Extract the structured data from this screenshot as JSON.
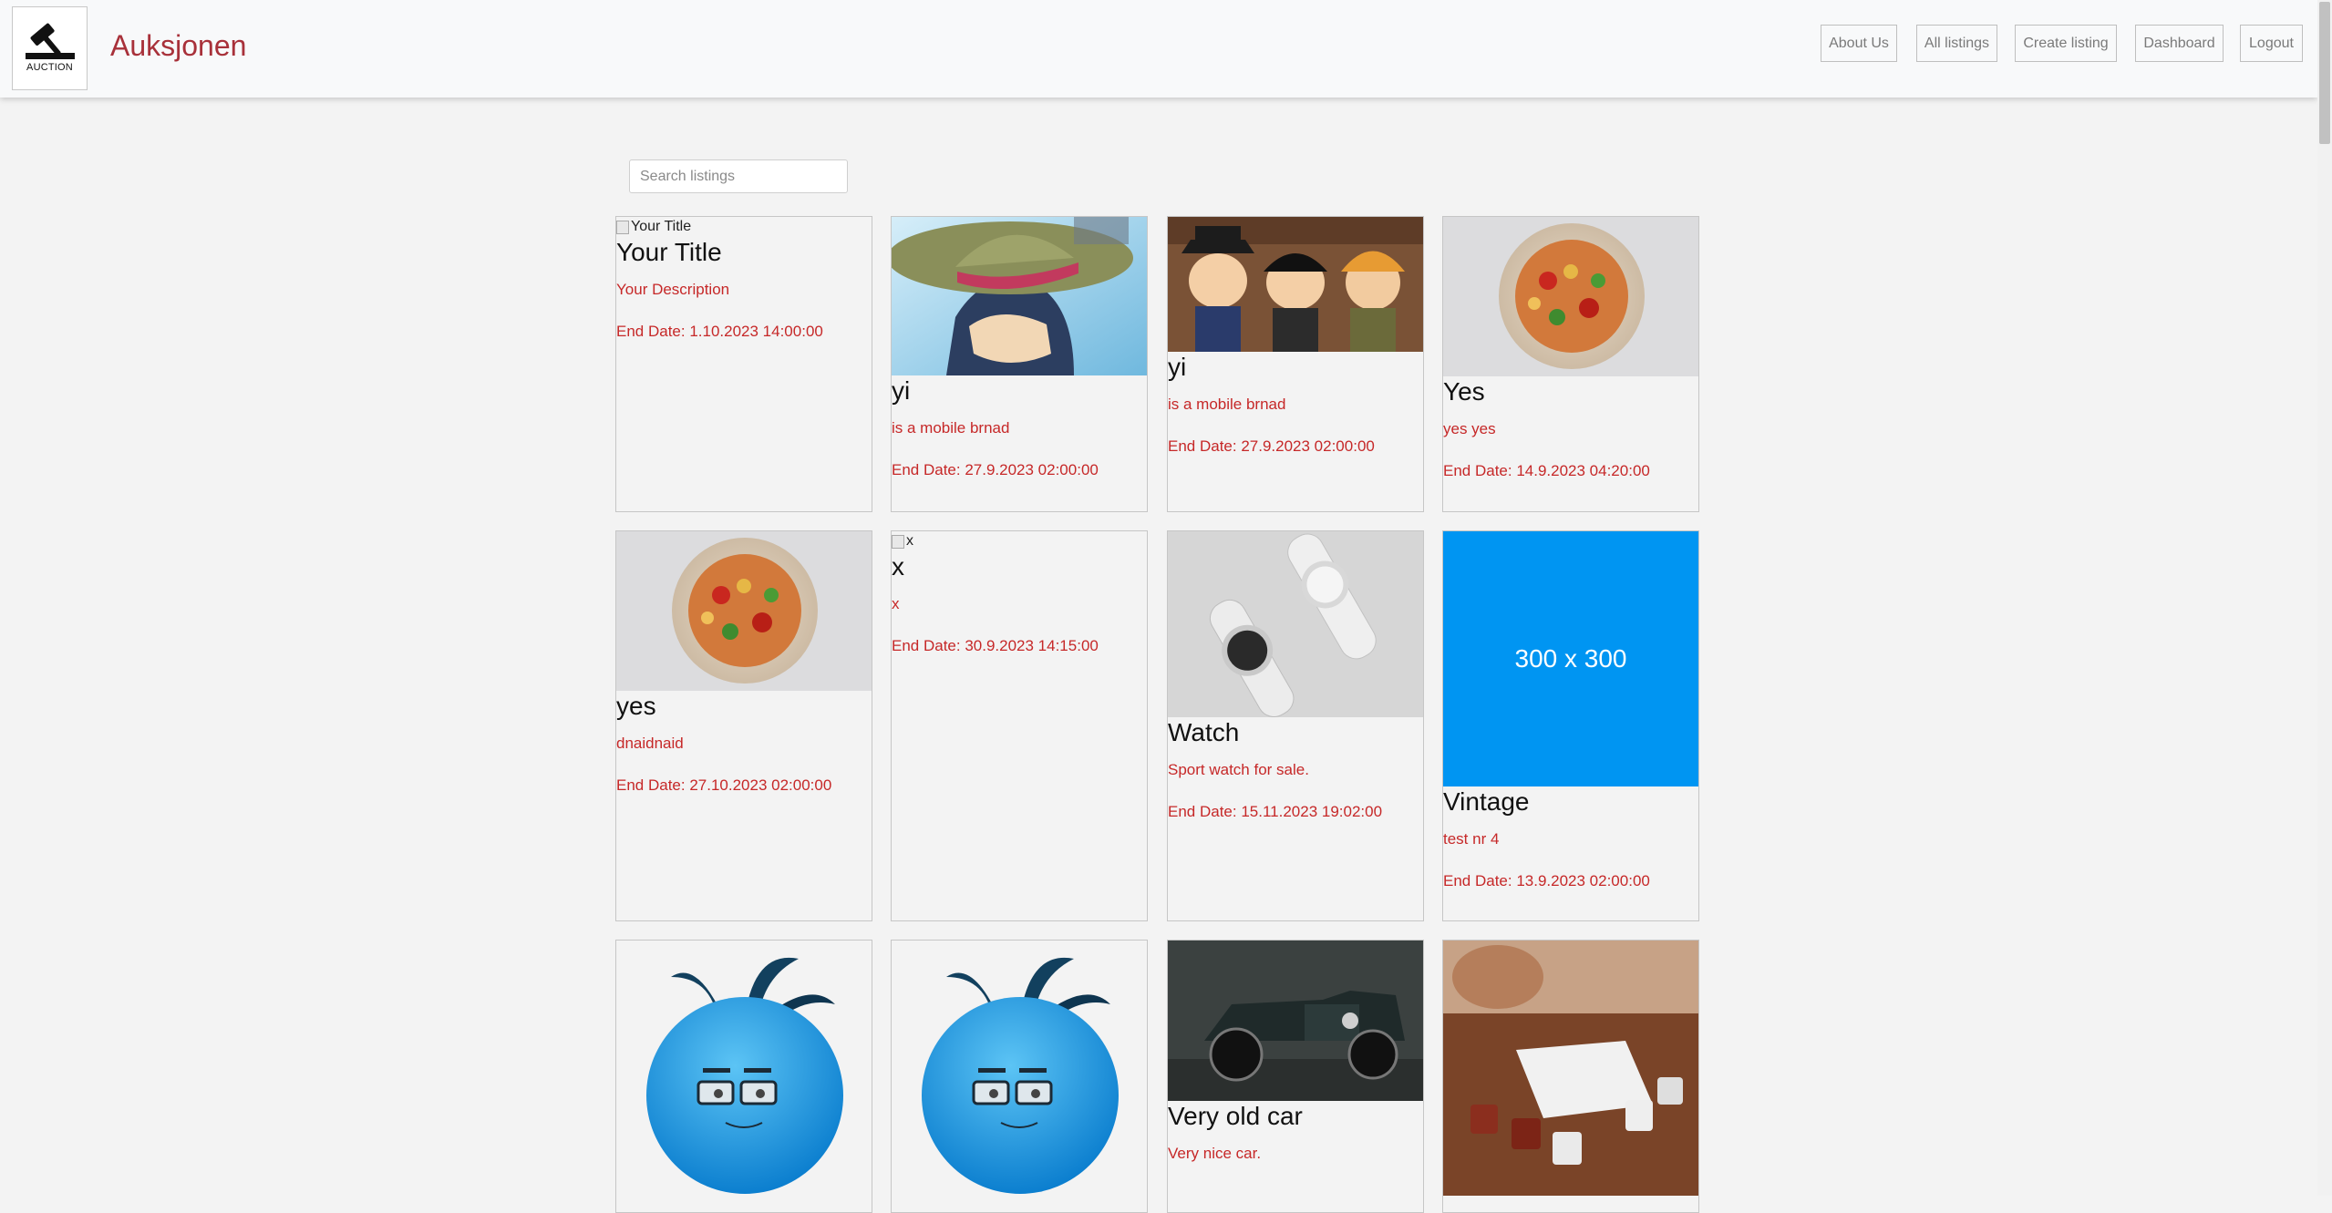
{
  "header": {
    "logo_text": "AUCTION",
    "brand": "Auksjonen",
    "nav": [
      "About Us",
      "All listings",
      "Create listing",
      "Dashboard",
      "Logout"
    ]
  },
  "search": {
    "placeholder": "Search listings"
  },
  "listings": [
    {
      "title": "Your Title",
      "description": "Your Description",
      "end_date": "End Date: 1.10.2023 14:00:00",
      "image": "broken",
      "alt": "Your Title"
    },
    {
      "title": "yi",
      "description": "is a mobile brnad",
      "end_date": "End Date: 27.9.2023 02:00:00",
      "image": "straw-hat-anime"
    },
    {
      "title": "yi",
      "description": "is a mobile brnad",
      "end_date": "End Date: 27.9.2023 02:00:00",
      "image": "three-anime-brothers"
    },
    {
      "title": "Yes",
      "description": "yes yes",
      "end_date": "End Date: 14.9.2023 04:20:00",
      "image": "pasta-plate"
    },
    {
      "title": "yes",
      "description": "dnaidnaid",
      "end_date": "End Date: 27.10.2023 02:00:00",
      "image": "pasta-plate"
    },
    {
      "title": "x",
      "description": "x",
      "end_date": "End Date: 30.9.2023 14:15:00",
      "image": "broken",
      "alt": "x"
    },
    {
      "title": "Watch",
      "description": "Sport watch for sale.",
      "end_date": "End Date: 15.11.2023 19:02:00",
      "image": "smart-watches"
    },
    {
      "title": "Vintage",
      "description": "test nr 4",
      "end_date": "End Date: 13.9.2023 02:00:00",
      "image": "placeholder",
      "placeholder_text": "300 x 300"
    },
    {
      "title": "",
      "description": "",
      "end_date": "",
      "image": "blue-face"
    },
    {
      "title": "",
      "description": "",
      "end_date": "",
      "image": "blue-face"
    },
    {
      "title": "Very old car",
      "description": "Very nice car.",
      "end_date": "",
      "image": "vintage-car"
    },
    {
      "title": "",
      "description": "",
      "end_date": "",
      "image": "coffee-cups"
    }
  ]
}
